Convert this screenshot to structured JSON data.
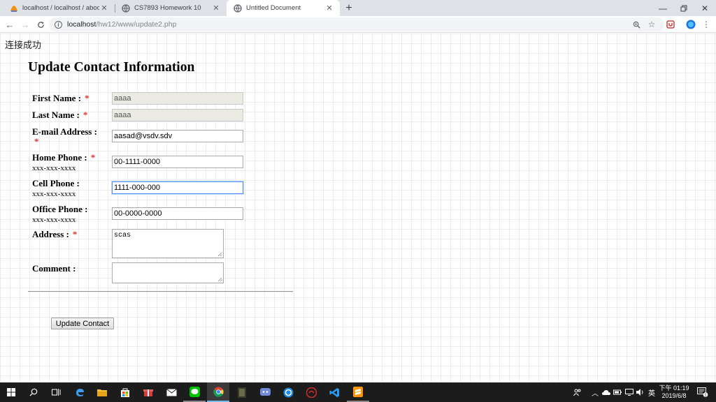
{
  "browser": {
    "tabs": [
      {
        "title": "localhost / localhost / abook / "
      },
      {
        "title": "CS7893 Homework 10"
      },
      {
        "title": "Untitled Document"
      }
    ],
    "url_host": "localhost",
    "url_path": "/hw12/www/update2.php"
  },
  "page": {
    "connect_status": "连接成功",
    "heading": "Update Contact Information",
    "phone_hint": "xxx-xxx-xxxx",
    "required_mark": "*",
    "fields": {
      "first_name": {
        "label": "First Name :",
        "value": "aaaa"
      },
      "last_name": {
        "label": "Last Name :",
        "value": "aaaa"
      },
      "email": {
        "label": "E-mail Address :",
        "value": "aasad@vsdv.sdv"
      },
      "home_phone": {
        "label": "Home Phone :",
        "value": "00-1111-0000"
      },
      "cell_phone": {
        "label": "Cell Phone :",
        "value": "1111-000-000"
      },
      "office_phone": {
        "label": "Office Phone :",
        "value": "00-0000-0000"
      },
      "address": {
        "label": "Address :",
        "value": "scas"
      },
      "comment": {
        "label": "Comment :",
        "value": ""
      }
    },
    "submit_label": "Update Contact"
  },
  "taskbar": {
    "ime_label": "英",
    "clock_time": "下午 01:19",
    "clock_date": "2019/6/8",
    "notification_count": "1"
  },
  "colors": {
    "required": "#d9342b",
    "focus_border": "#4d90fe",
    "readonly_bg": "#ebebe4",
    "taskbar_bg": "#1c1c1c"
  }
}
